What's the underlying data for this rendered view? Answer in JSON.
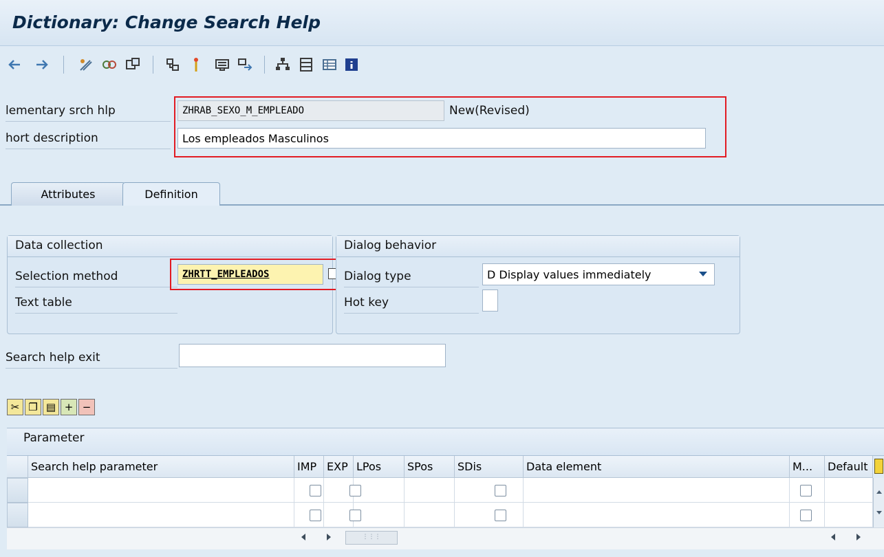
{
  "window": {
    "title": "Dictionary: Change Search Help"
  },
  "toolbar": {
    "icons": [
      "back-arrow-icon",
      "forward-arrow-icon",
      "display-change-icon",
      "check-icon",
      "activate-icon",
      "where-used-icon",
      "object-list-icon",
      "display-object-icon",
      "navigate-icon",
      "hierarchy-icon",
      "layout-icon",
      "table-icon",
      "info-icon"
    ]
  },
  "header": {
    "elementary_label": "lementary srch hlp",
    "elementary_value": "ZHRAB_SEXO_M_EMPLEADO",
    "status": "New(Revised)",
    "short_desc_label": "hort description",
    "short_desc_value": "Los empleados Masculinos"
  },
  "tabs": [
    {
      "label": "Attributes"
    },
    {
      "label": "Definition"
    }
  ],
  "data_collection": {
    "title": "Data collection",
    "selection_method_label": "Selection method",
    "selection_method_value": "ZHRTT_EMPLEADOS",
    "text_table_label": "Text table"
  },
  "dialog_behavior": {
    "title": "Dialog behavior",
    "dialog_type_label": "Dialog type",
    "dialog_type_value": "D Display values immediately",
    "hot_key_label": "Hot key"
  },
  "exit": {
    "label": "Search help exit"
  },
  "parameter": {
    "title": "Parameter",
    "columns": [
      "Search help parameter",
      "IMP",
      "EXP",
      "LPos",
      "SPos",
      "SDis",
      "Data element",
      "M...",
      "Default"
    ]
  },
  "colors": {
    "highlight": "#e21a22",
    "field_focus": "#fdf3b0",
    "info_blue": "#1f3f8f"
  }
}
